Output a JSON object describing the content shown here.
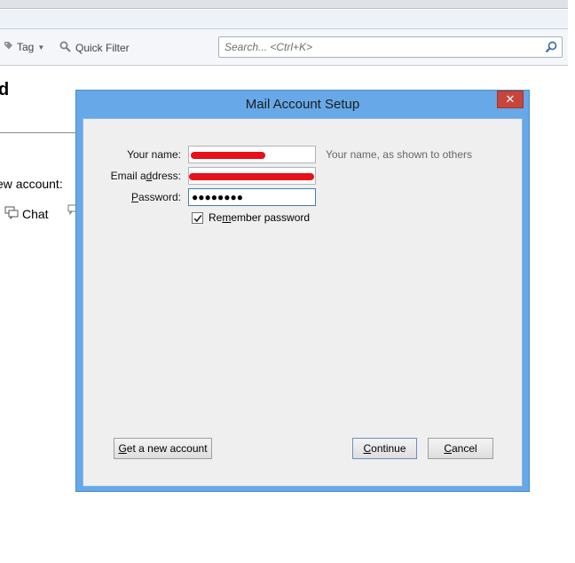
{
  "toolbar": {
    "tag_label": "Tag",
    "quick_filter_label": "Quick Filter",
    "search_placeholder": "Search... <Ctrl+K>"
  },
  "background": {
    "heading": "d",
    "new_account_text": "ew account:",
    "chat_label": "Chat"
  },
  "dialog": {
    "title": "Mail Account Setup",
    "close_glyph": "✕",
    "fields": {
      "name_label": "Your name:",
      "name_hint": "Your name, as shown to others",
      "email_label_pre": "Email a",
      "email_label_ul": "d",
      "email_label_post": "dress:",
      "password_label_ul": "P",
      "password_label_post": "assword:",
      "password_mask": "●●●●●●●●"
    },
    "remember": {
      "label_pre": "Re",
      "label_ul": "m",
      "label_post": "ember password",
      "checked": true
    },
    "buttons": {
      "get_account_ul": "G",
      "get_account_post": "et a new account",
      "continue_ul": "C",
      "continue_post": "ontinue",
      "cancel_ul": "C",
      "cancel_post": "ancel"
    }
  },
  "colors": {
    "dialog_frame": "#67a9e8",
    "close_button": "#c7463c",
    "redaction": "#e8101a"
  }
}
